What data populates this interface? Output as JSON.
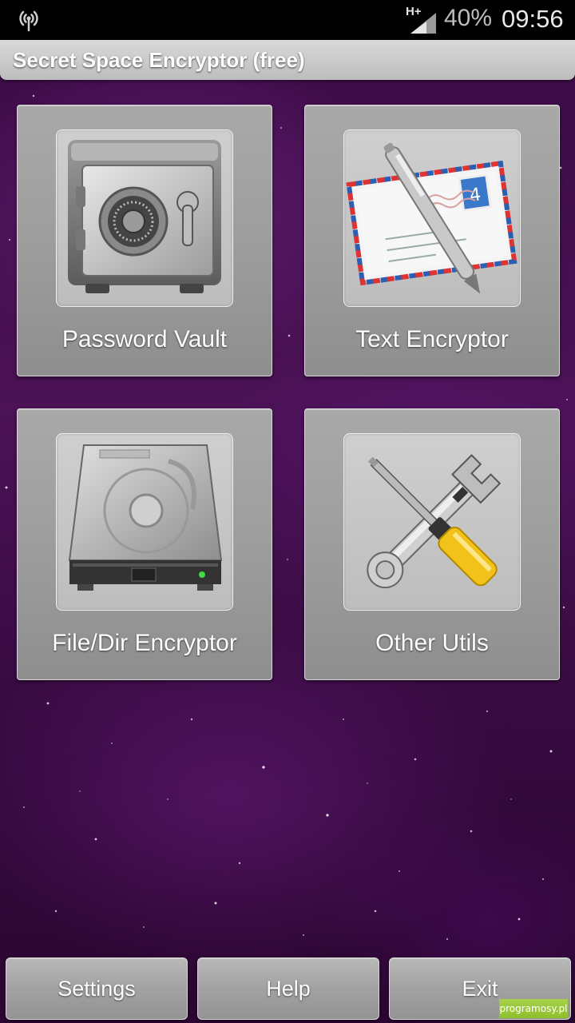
{
  "status_bar": {
    "signal_icon": "wireless-signal-icon",
    "network_label": "H+",
    "battery": "40%",
    "time": "09:56"
  },
  "app": {
    "title": "Secret Space Encryptor (free)"
  },
  "tiles": [
    {
      "label": "Password Vault",
      "icon": "safe-icon"
    },
    {
      "label": "Text Encryptor",
      "icon": "envelope-pen-icon"
    },
    {
      "label": "File/Dir Encryptor",
      "icon": "hard-drive-icon"
    },
    {
      "label": "Other Utils",
      "icon": "wrench-screwdriver-icon"
    }
  ],
  "bottom_bar": {
    "settings_label": "Settings",
    "help_label": "Help",
    "exit_label": "Exit"
  },
  "watermark": "programosy.pl",
  "colors": {
    "background": "#3a0a44",
    "tile": "#9c9c9c",
    "title_bar": "#c8c8c8"
  }
}
